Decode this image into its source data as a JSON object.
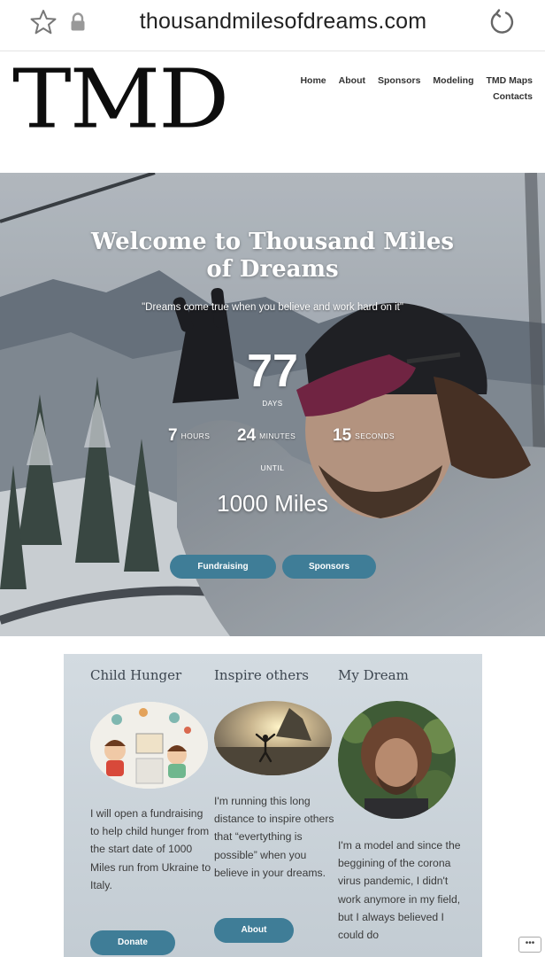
{
  "browser": {
    "url": "thousandmilesofdreams.com"
  },
  "header": {
    "logo": "TMD",
    "nav": [
      "Home",
      "About",
      "Sponsors",
      "Modeling",
      "TMD Maps",
      "Contacts"
    ]
  },
  "hero": {
    "title": "Welcome to Thousand Miles of Dreams",
    "quote": "\"Dreams come true when you believe and work hard on it\"",
    "countdown": {
      "days": "77",
      "days_label": "DAYS",
      "hours": "7",
      "hours_label": "HOURS",
      "minutes": "24",
      "minutes_label": "MINUTES",
      "seconds": "15",
      "seconds_label": "SECONDS",
      "until_label": "UNTIL",
      "target": "1000 Miles"
    },
    "buttons": [
      "Fundraising",
      "Sponsors"
    ]
  },
  "features": [
    {
      "title": "Child Hunger",
      "text": "I will open a fundraising to help child hunger from the start date of 1000 Miles run from Ukraine to Italy.",
      "button": "Donate"
    },
    {
      "title": "Inspire others",
      "text": "I'm running this long distance to inspire others that “evertything is possible” when you believe in your dreams.",
      "button": "About"
    },
    {
      "title": "My Dream",
      "text": "I'm a model and since the beggining of the corona virus pandemic, I didn't work anymore in my field, but I always believed I could do"
    }
  ],
  "colors": {
    "accent": "#3f7d97",
    "panel": "#cdd5db"
  },
  "icons": [
    "star-icon",
    "lock-icon",
    "reload-icon",
    "more-icon"
  ]
}
